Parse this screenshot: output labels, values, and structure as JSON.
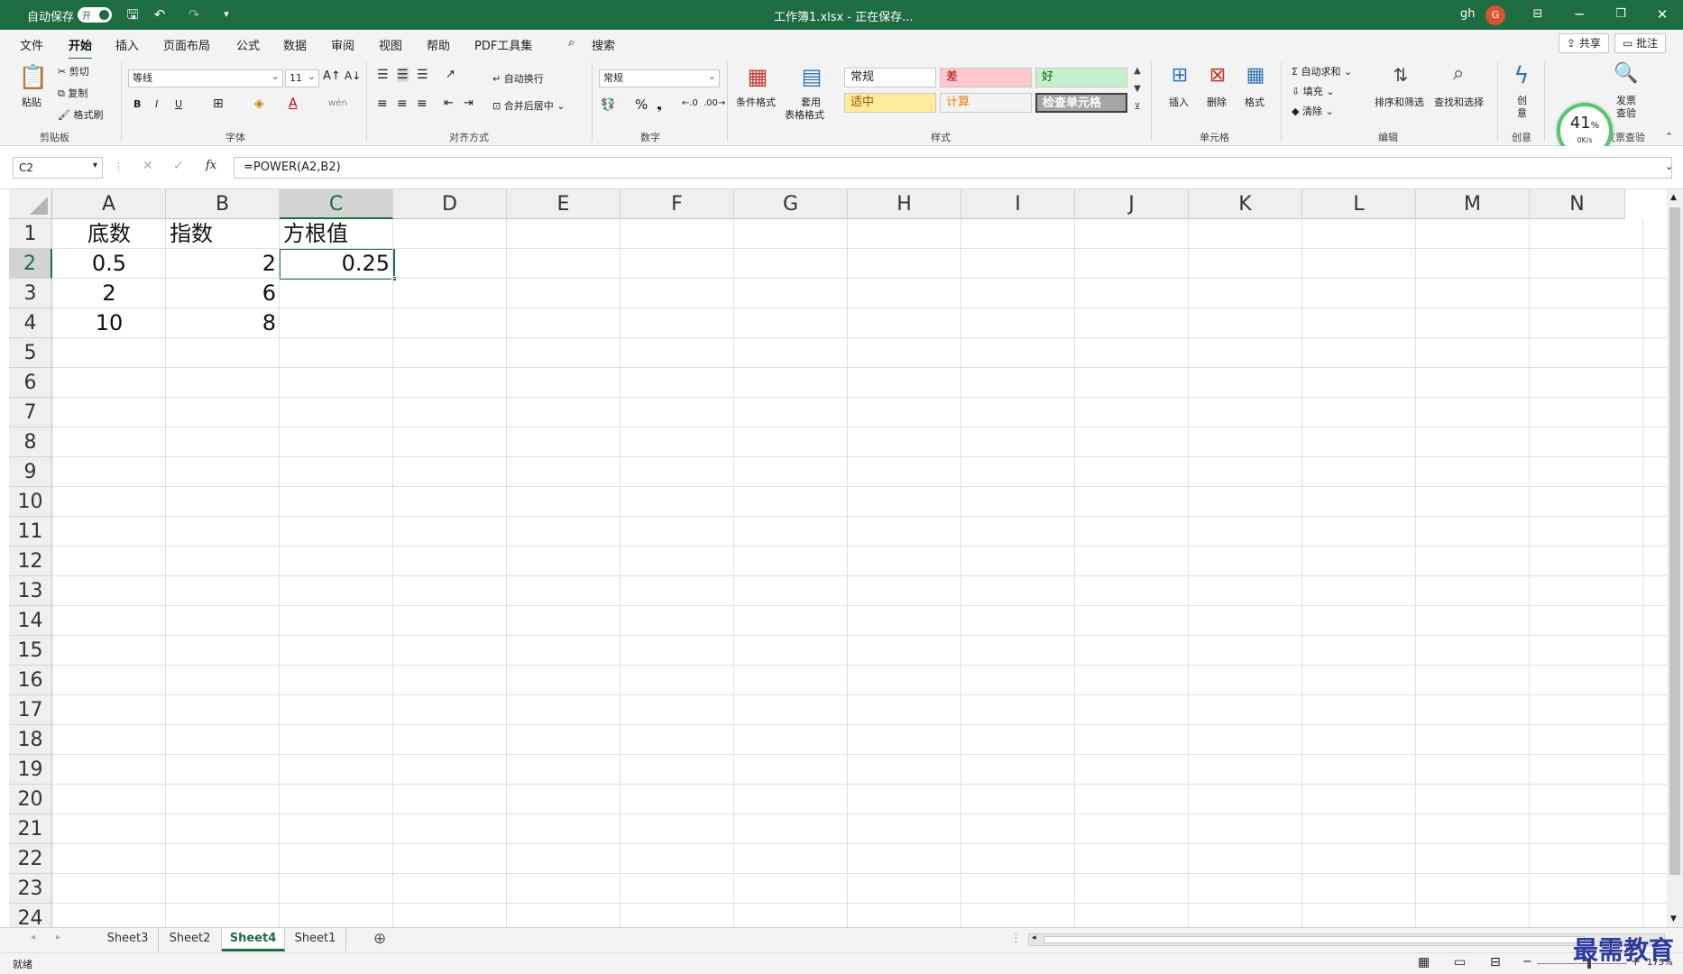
{
  "titlebar": {
    "autosave_label": "自动保存",
    "autosave_state": "开",
    "title": "工作簿1.xlsx - 正在保存...",
    "user": "gh",
    "avatar_letter": "G",
    "accent": "#1e6c41"
  },
  "menu": {
    "tabs": [
      "文件",
      "开始",
      "插入",
      "页面布局",
      "公式",
      "数据",
      "审阅",
      "视图",
      "帮助",
      "PDF工具集"
    ],
    "active_tab": "开始",
    "search_label": "搜索",
    "share_label": "共享",
    "comment_label": "批注"
  },
  "ribbon": {
    "clipboard": {
      "paste": "粘贴",
      "cut": "剪切",
      "copy": "复制",
      "format_painter": "格式刷",
      "group": "剪贴板"
    },
    "font": {
      "name": "等线",
      "size": "11",
      "bold": "B",
      "italic": "I",
      "underline": "U",
      "group": "字体"
    },
    "alignment": {
      "wrap": "自动换行",
      "merge": "合并后居中",
      "group": "对齐方式"
    },
    "number": {
      "format": "常规",
      "group": "数字"
    },
    "styles": {
      "conditional": "条件格式",
      "table_format_1": "套用",
      "table_format_2": "表格格式",
      "cells": [
        {
          "label": "常规",
          "bg": "#ffffff",
          "color": "#222222"
        },
        {
          "label": "差",
          "bg": "#ffc7ce",
          "color": "#9c0006"
        },
        {
          "label": "好",
          "bg": "#c6efce",
          "color": "#006100"
        },
        {
          "label": "适中",
          "bg": "#ffeb9c",
          "color": "#9c5700"
        },
        {
          "label": "计算",
          "bg": "#f2f2f2",
          "color": "#fa7d00"
        },
        {
          "label": "检查单元格",
          "bg": "#a5a5a5",
          "color": "#ffffff"
        }
      ],
      "group": "样式"
    },
    "cells": {
      "insert": "插入",
      "delete": "删除",
      "format": "格式",
      "group": "单元格"
    },
    "editing": {
      "autosum": "自动求和",
      "fill": "填充",
      "clear": "清除",
      "sort": "排序和筛选",
      "find": "查找和选择",
      "group": "编辑"
    },
    "creative": {
      "label_1": "创",
      "label_2": "意",
      "group": "创意"
    },
    "invoice": {
      "label_1": "发票",
      "label_2": "查验",
      "group": "发票查验"
    },
    "gauge": {
      "percent": "41",
      "unit": "%",
      "speed": "0K/s"
    }
  },
  "formula_bar": {
    "name_box": "C2",
    "formula": "=POWER(A2,B2)",
    "fx": "fx"
  },
  "grid": {
    "columns": [
      "A",
      "B",
      "C",
      "D",
      "E",
      "F",
      "G",
      "H",
      "I",
      "J",
      "K",
      "L",
      "M",
      "N"
    ],
    "selected_column": "C",
    "rows": [
      "1",
      "2",
      "3",
      "4",
      "5",
      "6",
      "7",
      "8",
      "9",
      "10",
      "11",
      "12",
      "13",
      "14",
      "15",
      "16",
      "17",
      "18",
      "19",
      "20",
      "21",
      "22",
      "23",
      "24"
    ],
    "selected_row": "2",
    "cells": {
      "A1": "底数",
      "B1": "指数",
      "C1": "方根值",
      "A2": "0.5",
      "B2": "2",
      "C2": "0.25",
      "A3": "2",
      "B3": "6",
      "A4": "10",
      "B4": "8"
    }
  },
  "sheets": {
    "tabs": [
      "Sheet3",
      "Sheet2",
      "Sheet4",
      "Sheet1"
    ],
    "active": "Sheet4"
  },
  "status": {
    "ready": "就绪",
    "zoom": "175%"
  },
  "watermark": "最需教育"
}
